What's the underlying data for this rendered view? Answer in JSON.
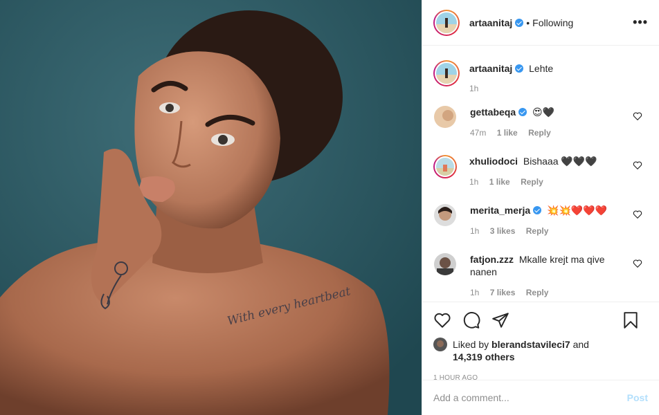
{
  "post": {
    "image_alt": "Portrait of a woman with a tattoo on her collarbone and wrist",
    "tattoo_text": "With every heartbeat"
  },
  "header": {
    "username": "artaanitaj",
    "separator": "•",
    "follow_status": "Following",
    "more_icon": "more-horizontal-icon"
  },
  "caption": {
    "username": "artaanitaj",
    "text": "Lehte",
    "time": "1h"
  },
  "comments": [
    {
      "username": "gettabeqa",
      "verified": true,
      "text": "😍🖤",
      "time": "47m",
      "likes": "1 like",
      "reply": "Reply"
    },
    {
      "username": "xhuliodoci",
      "verified": false,
      "text": "Bishaaa 🖤🖤🖤",
      "time": "1h",
      "likes": "1 like",
      "reply": "Reply"
    },
    {
      "username": "merita_merja",
      "verified": true,
      "text": "💥💥❤️❤️❤️",
      "time": "1h",
      "likes": "3 likes",
      "reply": "Reply"
    },
    {
      "username": "fatjon.zzz",
      "verified": false,
      "text": "Mkalle krejt ma qive nanen",
      "time": "1h",
      "likes": "7 likes",
      "reply": "Reply"
    }
  ],
  "actions": {
    "like_icon": "heart-icon",
    "comment_icon": "comment-icon",
    "share_icon": "share-icon",
    "save_icon": "bookmark-icon"
  },
  "likes": {
    "prefix": "Liked by",
    "user": "blerandstavileci7",
    "joiner": "and",
    "others": "14,319 others"
  },
  "time_ago": "1 HOUR AGO",
  "add_comment": {
    "placeholder": "Add a comment...",
    "post_label": "Post"
  },
  "colors": {
    "background_photo": "#2e5962",
    "verified": "#3897f0",
    "post_button": "#b2dffc",
    "meta_gray": "#8e8e8e"
  }
}
